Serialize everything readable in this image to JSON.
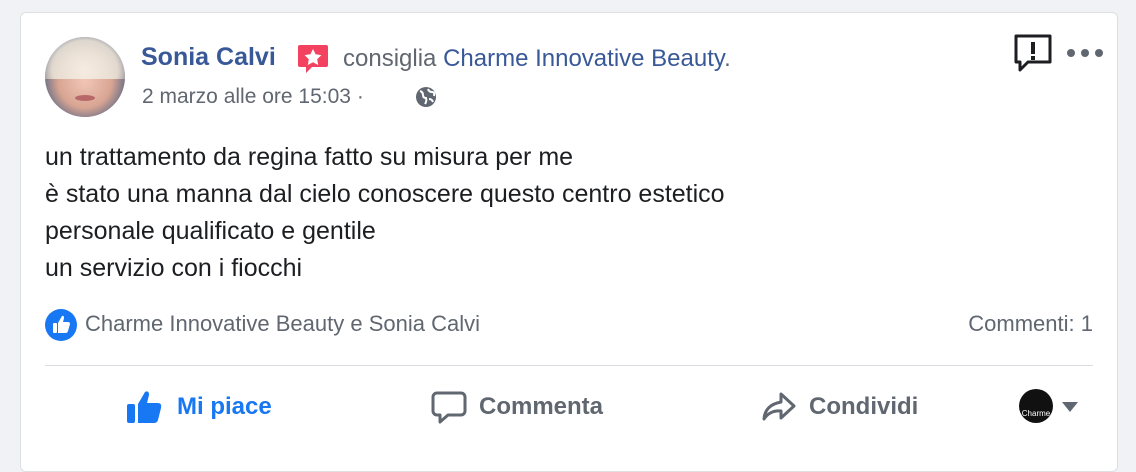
{
  "post": {
    "author_name": "Sonia Calvi",
    "action_text": "consiglia",
    "page_name": "Charme Innovative Beauty",
    "page_suffix": ".",
    "timestamp": "2 marzo alle ore 15:03",
    "separator": "·",
    "body_lines": [
      "un trattamento da regina fatto su misura per me",
      "è stato una manna dal cielo conoscere questo centro estetico",
      "personale qualificato e gentile",
      "un servizio con i fiocchi"
    ]
  },
  "reactions": {
    "names": "Charme Innovative Beauty e Sonia Calvi",
    "comments": "Commenti: 1"
  },
  "actions": {
    "like": "Mi piace",
    "comment": "Commenta",
    "share": "Condividi"
  },
  "page_avatar_text": "Charme",
  "icons": {
    "badge": "recommendation-star-icon",
    "audience": "globe-icon",
    "report": "report-icon",
    "more": "more-options-icon",
    "like_badge": "thumbs-up-icon",
    "comment": "comment-bubble-icon",
    "share": "share-arrow-icon",
    "dropdown": "chevron-down-icon"
  },
  "colors": {
    "link": "#385898",
    "like_blue": "#1877f2",
    "badge_red": "#f3425f",
    "secondary_text": "#606770"
  }
}
